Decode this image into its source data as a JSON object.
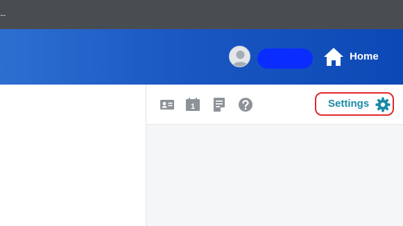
{
  "topbar": {
    "overflow_text": "..."
  },
  "header": {
    "avatar_icon": "user-avatar-icon",
    "user_name_redacted": true,
    "home_icon": "home-icon",
    "home_label": "Home",
    "gradient_colors": [
      "#2c6fd1",
      "#0c49b6"
    ]
  },
  "toolbar": {
    "icons": [
      "contact-card-icon",
      "calendar-icon",
      "notes-icon",
      "help-icon"
    ],
    "calendar_day": "1",
    "settings_label": "Settings",
    "settings_icon": "gear-icon",
    "accent_color": "#1a8ba6",
    "highlight_color": "#e0262b"
  }
}
